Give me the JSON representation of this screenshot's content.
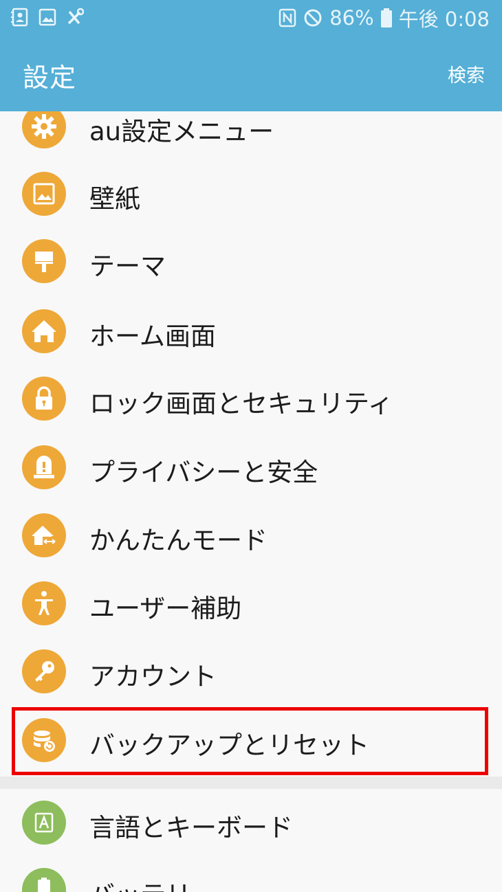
{
  "status_bar": {
    "notification_icons": [
      "contacts-icon",
      "gallery-icon",
      "tools-icon"
    ],
    "status_icons": [
      "nfc-icon",
      "do-not-disturb-icon",
      "battery-icon"
    ],
    "battery": "86%",
    "time": "午後 0:08"
  },
  "app_bar": {
    "title": "設定",
    "search": "検索"
  },
  "colors": {
    "app_bar": "#55afd6",
    "icon_orange": "#eea838",
    "icon_green": "#8dbd5c",
    "highlight": "#ec0000",
    "background": "#f8f8f8"
  },
  "settings": {
    "items": [
      {
        "label": "au設定メニュー",
        "icon": "gear-icon"
      },
      {
        "label": "壁紙",
        "icon": "wallpaper-icon"
      },
      {
        "label": "テーマ",
        "icon": "theme-brush-icon"
      },
      {
        "label": "ホーム画面",
        "icon": "home-icon"
      },
      {
        "label": "ロック画面とセキュリティ",
        "icon": "lock-icon"
      },
      {
        "label": "プライバシーと安全",
        "icon": "alert-light-icon"
      },
      {
        "label": "かんたんモード",
        "icon": "easy-mode-icon"
      },
      {
        "label": "ユーザー補助",
        "icon": "accessibility-icon"
      },
      {
        "label": "アカウント",
        "icon": "key-icon"
      },
      {
        "label": "バックアップとリセット",
        "icon": "backup-reset-icon",
        "highlighted": true
      },
      {
        "label": "言語とキーボード",
        "icon": "language-icon"
      },
      {
        "label": "バッテリ",
        "icon": "battery-icon"
      }
    ]
  }
}
